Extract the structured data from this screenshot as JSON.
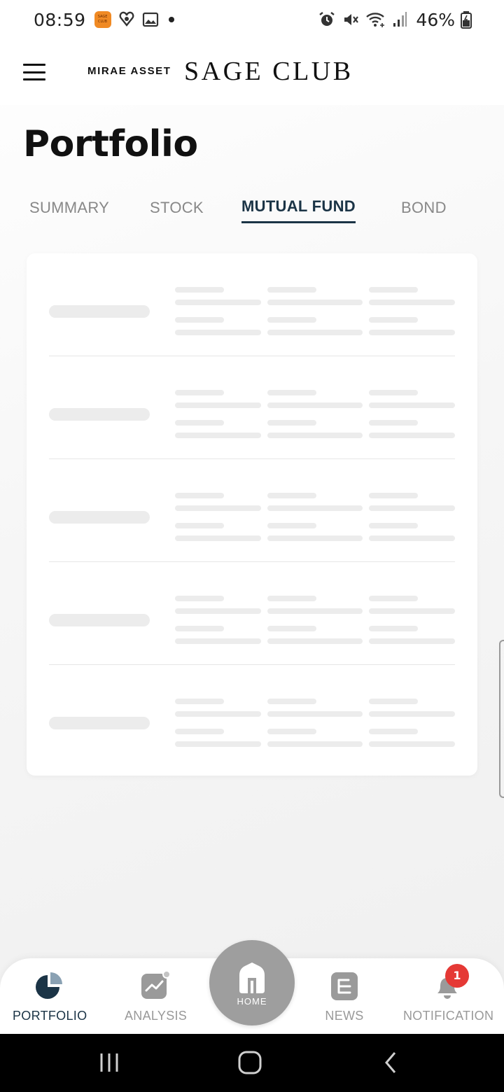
{
  "status_bar": {
    "time": "08:59",
    "battery": "46%",
    "app_badge": "SAGE CLUB",
    "left_icons": [
      "sage-club-app-icon",
      "heart-notification-icon",
      "gallery-icon",
      "dot-indicator"
    ],
    "right_icons": [
      "alarm-icon",
      "mute-icon",
      "wifi-icon",
      "signal-icon",
      "battery-icon"
    ]
  },
  "header": {
    "brand_small": "MIRAE ASSET",
    "brand_large": "SAGE CLUB"
  },
  "page": {
    "title": "Portfolio"
  },
  "tabs": [
    {
      "label": "SUMMARY",
      "active": false
    },
    {
      "label": "STOCK",
      "active": false
    },
    {
      "label": "MUTUAL FUND",
      "active": true
    },
    {
      "label": "BOND",
      "active": false
    }
  ],
  "content": {
    "state": "loading",
    "skeleton_rows": 5
  },
  "bottom_nav": {
    "items": [
      {
        "label": "PORTFOLIO",
        "icon": "pie-chart-icon",
        "active": true
      },
      {
        "label": "ANALYSIS",
        "icon": "trend-chart-icon",
        "active": false
      },
      {
        "label": "HOME",
        "icon": "home-icon",
        "active": false
      },
      {
        "label": "NEWS",
        "icon": "news-icon",
        "active": false
      },
      {
        "label": "NOTIFICATION",
        "icon": "bell-icon",
        "active": false
      }
    ],
    "notification_count": "1"
  },
  "colors": {
    "accent": "#1b3446",
    "inactive": "#999999",
    "badge": "#e53935",
    "home_button": "#9e9e9e",
    "skeleton": "#ececec"
  }
}
